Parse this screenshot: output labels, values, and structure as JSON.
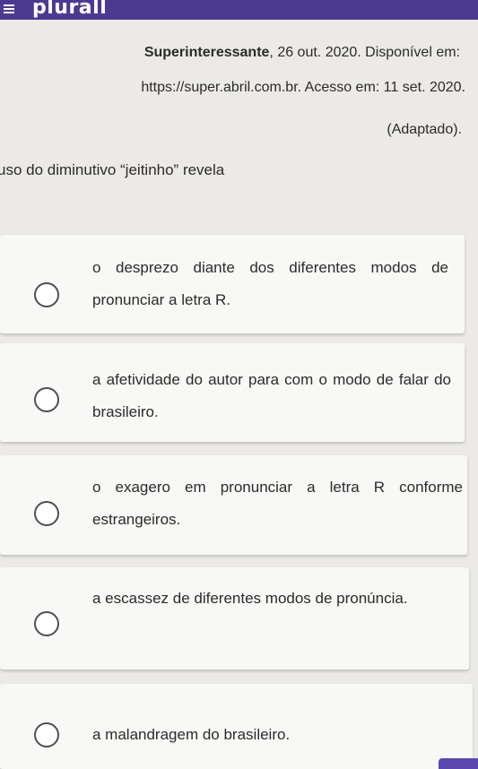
{
  "app": {
    "logo_text": "plurall",
    "menu_icon": "hamburger-menu-icon"
  },
  "source": {
    "publication": "Superinteressante",
    "date_available": ", 26 out. 2020. Disponível em:",
    "url_line": "https://super.abril.com.br. Acesso em: 11 set. 2020.",
    "adapted": "(Adaptado)."
  },
  "question": {
    "stem": "uso do diminutivo “jeitinho” revela"
  },
  "options": [
    {
      "label": "o desprezo diante dos diferentes modos de pronunciar a letra R."
    },
    {
      "label": "a afetividade do autor para com o modo de falar do brasileiro."
    },
    {
      "label": "o exagero em pronunciar a letra R conforme estrangeiros."
    },
    {
      "label": "a escassez de diferentes modos de pronúncia."
    },
    {
      "label": "a malandragem do brasileiro."
    }
  ],
  "colors": {
    "header": "#4b3a8f",
    "card": "#f8f8f6",
    "background": "#eceae6",
    "accent_tab": "#5b47b0"
  }
}
